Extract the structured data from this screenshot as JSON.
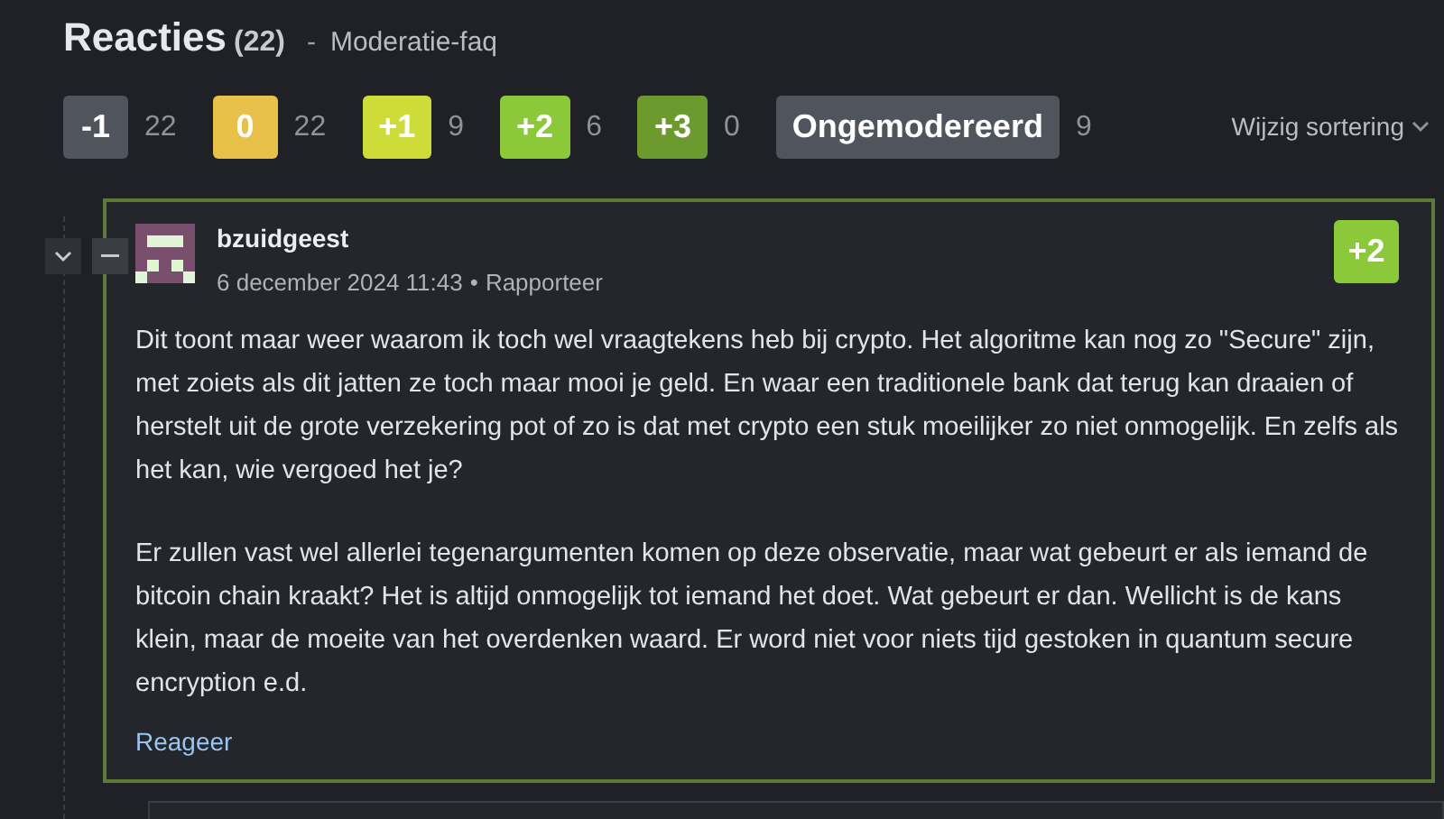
{
  "header": {
    "title": "Reacties",
    "count": "(22)",
    "separator": "-",
    "link": "Moderatie-faq"
  },
  "filters": [
    {
      "label": "-1",
      "count": "22",
      "color": "#50545c"
    },
    {
      "label": "0",
      "count": "22",
      "color": "#e8c14a"
    },
    {
      "label": "+1",
      "count": "9",
      "color": "#cddc39"
    },
    {
      "label": "+2",
      "count": "6",
      "color": "#8bc83a"
    },
    {
      "label": "+3",
      "count": "0",
      "color": "#6c9a2e"
    },
    {
      "label": "Ongemodereerd",
      "count": "9",
      "color": "#50545c"
    }
  ],
  "sort": {
    "label": "Wijzig sortering"
  },
  "comment": {
    "author": "bzuidgeest",
    "date": "6 december 2024 11:43",
    "bullet": "•",
    "report": "Rapporteer",
    "score": {
      "label": "+2",
      "color": "#8bc83a"
    },
    "paragraphs": [
      "Dit toont maar weer waarom ik toch wel vraagtekens heb bij crypto. Het algoritme kan nog zo \"Secure\" zijn, met zoiets als dit jatten ze toch maar mooi je geld. En waar een traditionele bank dat terug kan draaien of herstelt uit de grote verzekering pot of zo is dat met crypto een stuk moeilijker zo niet onmogelijk. En zelfs als het kan, wie vergoed het je?",
      "Er zullen vast wel allerlei tegenargumenten komen op deze observatie, maar wat gebeurt er als iemand de bitcoin chain kraakt? Het is altijd onmogelijk tot iemand het doet. Wat gebeurt er dan. Wellicht is de kans klein, maar de moeite van het overdenken waard. Er word niet voor niets tijd gestoken in quantum secure encryption e.d."
    ],
    "reply": "Reageer"
  }
}
